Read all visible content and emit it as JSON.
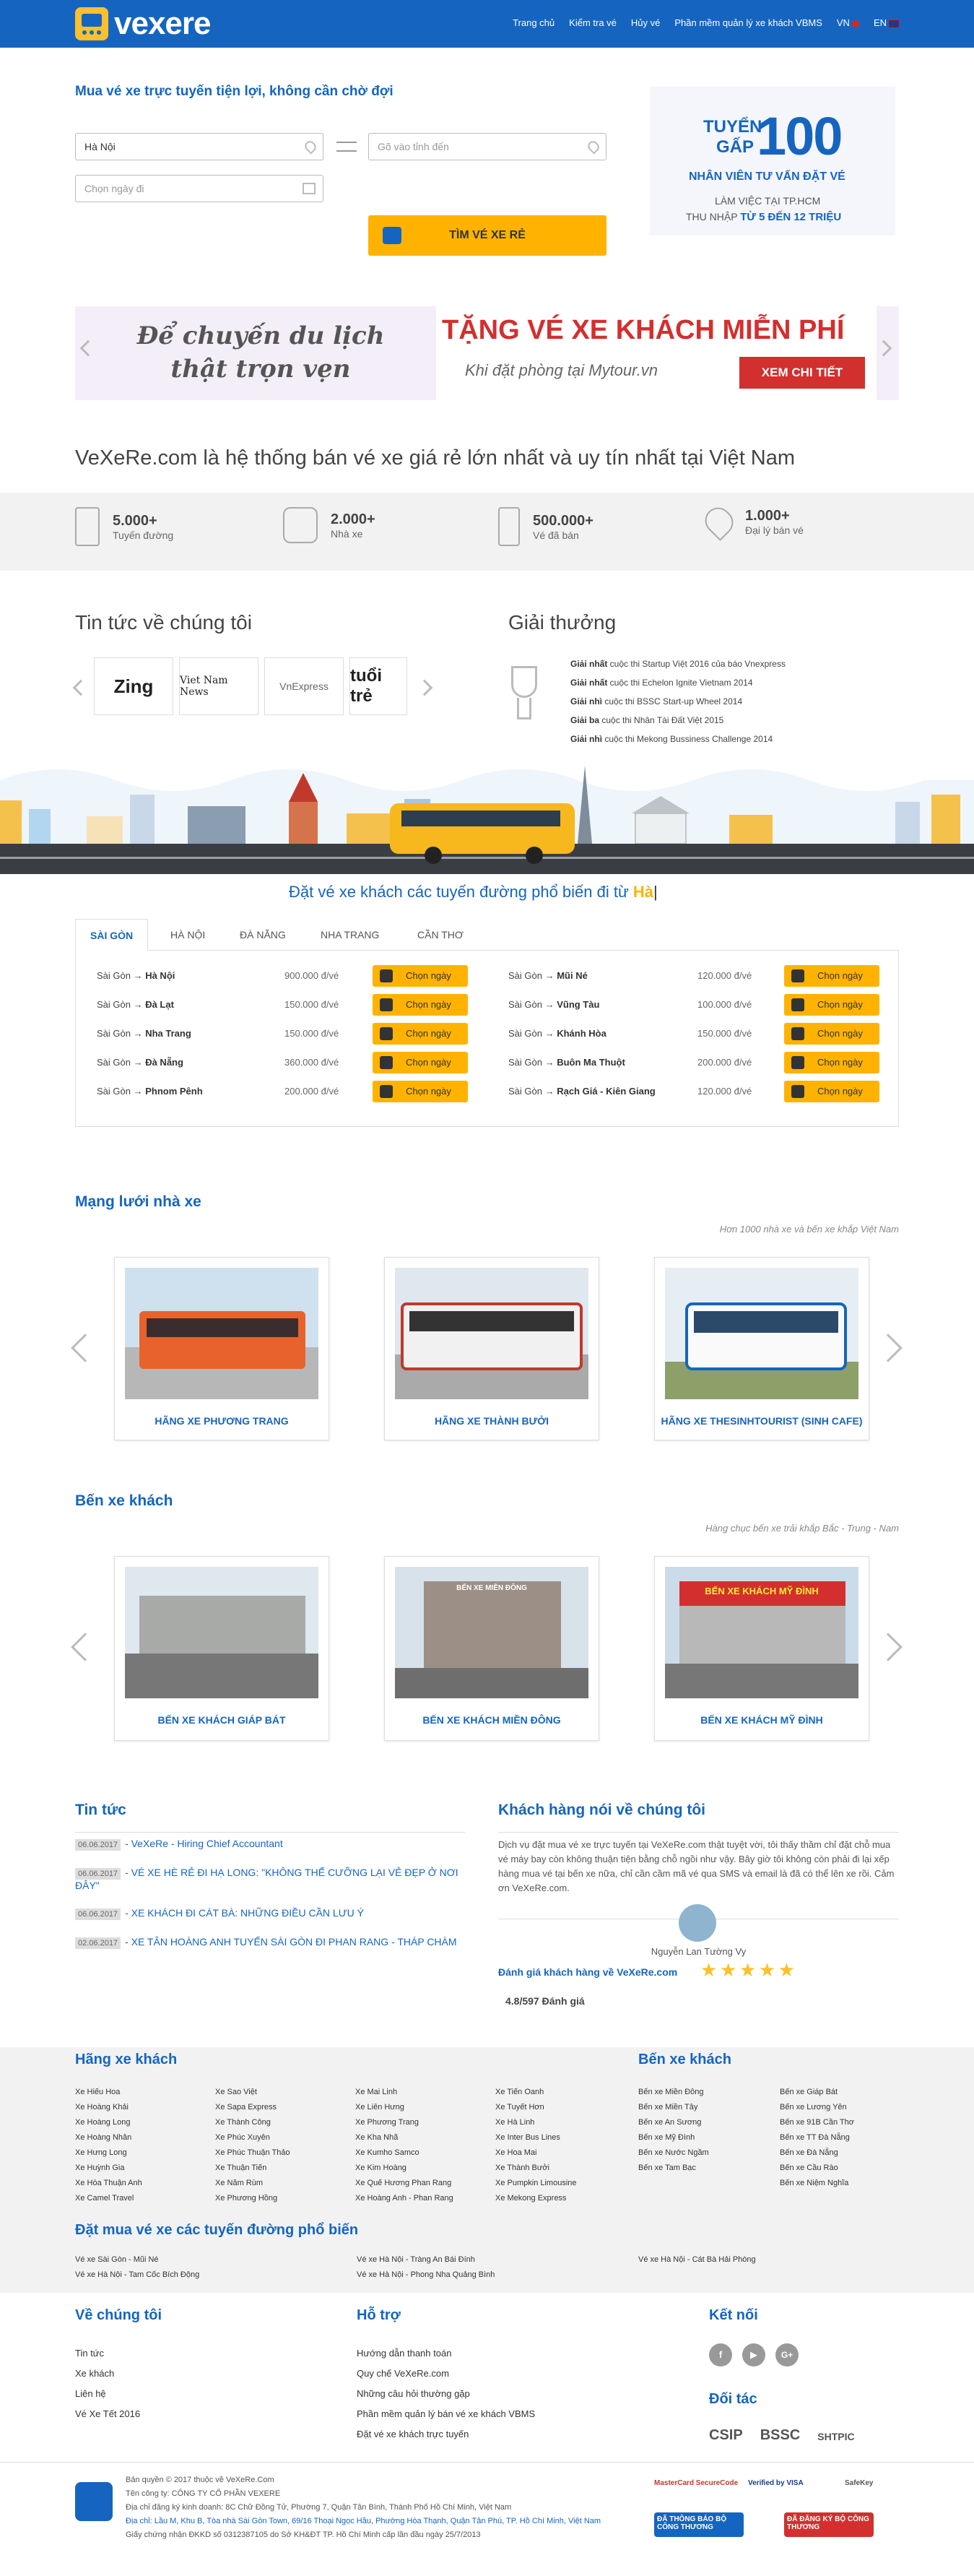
{
  "header": {
    "logo": "vexere",
    "nav": [
      "Trang chủ",
      "Kiểm tra vé",
      "Hủy vé",
      "Phần mềm quản lý xe khách VBMS"
    ],
    "lang_vn": "VN",
    "lang_en": "EN"
  },
  "search": {
    "heading": "Mua vé xe trực tuyến tiện lợi, không cần chờ đợi",
    "from_value": "Hà Nội",
    "to_placeholder": "Gõ vào tỉnh đến",
    "date_placeholder": "Chọn ngày đi",
    "button": "TÌM VÉ XE RẺ"
  },
  "hiring": {
    "line1": "TUYỂN",
    "line2": "GẤP",
    "number": "100",
    "line3": "NHÂN VIÊN TƯ VẤN ĐẶT VÉ",
    "line4": "LÀM VIỆC TẠI TP.HCM",
    "line5a": "THU NHẬP",
    "line5b": "TỪ 5 ĐẾN 12 TRIỆU"
  },
  "banner": {
    "left1": "Để chuyến du lịch",
    "left2": "thật trọn vẹn",
    "title": "TẶNG VÉ XE KHÁCH MIỄN PHÍ",
    "sub": "Khi đặt phòng tại Mytour.vn",
    "cta": "XEM CHI TIẾT"
  },
  "intro": "VeXeRe.com là hệ thống bán vé xe giá rẻ lớn nhất và uy tín nhất tại Việt Nam",
  "stats": [
    {
      "num": "5.000+",
      "label": "Tuyến đường"
    },
    {
      "num": "2.000+",
      "label": "Nhà xe"
    },
    {
      "num": "500.000+",
      "label": "Vé đã bán"
    },
    {
      "num": "1.000+",
      "label": "Đại lý bán vé"
    }
  ],
  "news_about": {
    "title": "Tin tức về chúng tôi",
    "logos": [
      "Zing",
      "Viet Nam News",
      "VnExpress",
      "tuổi trẻ"
    ]
  },
  "awards": {
    "title": "Giải thưởng",
    "items": [
      {
        "rank": "Giải nhất",
        "text": " cuộc thi Startup Việt 2016 của báo Vnexpress"
      },
      {
        "rank": "Giải nhất",
        "text": " cuộc thi Echelon Ignite Vietnam 2014"
      },
      {
        "rank": "Giải nhì",
        "text": " cuộc thi BSSC Start-up Wheel 2014"
      },
      {
        "rank": "Giải ba",
        "text": " cuộc thi Nhân Tài Đất Việt 2015"
      },
      {
        "rank": "Giải nhì",
        "text": " cuộc thi Mekong Bussiness Challenge 2014"
      }
    ]
  },
  "popular": {
    "title": "Đặt vé xe khách các tuyến đường phổ biến đi từ",
    "city": "Hà",
    "tabs": [
      "SÀI GÒN",
      "HÀ NỘI",
      "ĐÀ NẴNG",
      "NHA TRANG",
      "CẦN THƠ"
    ],
    "choose": "Chọn ngày",
    "left": [
      {
        "from": "Sài Gòn → ",
        "to": "Hà Nội",
        "price": "900.000 đ/vé"
      },
      {
        "from": "Sài Gòn → ",
        "to": "Đà Lạt",
        "price": "150.000 đ/vé"
      },
      {
        "from": "Sài Gòn → ",
        "to": "Nha Trang",
        "price": "150.000 đ/vé"
      },
      {
        "from": "Sài Gòn → ",
        "to": "Đà Nẵng",
        "price": "360.000 đ/vé"
      },
      {
        "from": "Sài Gòn → ",
        "to": "Phnom Pênh",
        "price": "200.000 đ/vé"
      }
    ],
    "right": [
      {
        "from": "Sài Gòn → ",
        "to": "Mũi Né",
        "price": "120.000 đ/vé"
      },
      {
        "from": "Sài Gòn → ",
        "to": "Vũng Tàu",
        "price": "100.000 đ/vé"
      },
      {
        "from": "Sài Gòn → ",
        "to": "Khánh Hòa",
        "price": "150.000 đ/vé"
      },
      {
        "from": "Sài Gòn → ",
        "to": "Buôn Ma Thuột",
        "price": "200.000 đ/vé"
      },
      {
        "from": "Sài Gòn → ",
        "to": "Rạch Giá - Kiên Giang",
        "price": "120.000 đ/vé"
      }
    ]
  },
  "network": {
    "title": "Mạng lưới nhà xe",
    "sub": "Hơn 1000 nhà xe và bến xe khắp Việt Nam",
    "cards": [
      "HÃNG XE PHƯƠNG TRANG",
      "HÃNG XE THÀNH BƯỞI",
      "HÃNG XE THESINHTOURIST (SINH CAFE)"
    ]
  },
  "stations": {
    "title": "Bến xe khách",
    "sub": "Hàng chục bến xe trải khắp Bắc - Trung - Nam",
    "cards": [
      "BẾN XE KHÁCH GIÁP BÁT",
      "BẾN XE KHÁCH MIỀN ĐÔNG",
      "BẾN XE KHÁCH MỸ ĐÌNH"
    ],
    "sign1": "BẾN XE MIỀN ĐÔNG",
    "sign2": "BẾN XE KHÁCH MỸ ĐÌNH"
  },
  "news": {
    "title": "Tin tức",
    "items": [
      {
        "date": "06.06.2017",
        "text": "- VeXeRe - Hiring Chief Accountant"
      },
      {
        "date": "06.06.2017",
        "text": "- VÉ XE HÈ RẺ ĐI HẠ LONG: \"KHÔNG THỂ CƯỠNG LẠI VẺ ĐẸP Ở NƠI ĐÂY\""
      },
      {
        "date": "06.06.2017",
        "text": "- XE KHÁCH ĐI CÁT BÀ: NHỮNG ĐIỀU CẦN LƯU Ý"
      },
      {
        "date": "02.06.2017",
        "text": "- XE TÂN HOÀNG ANH TUYẾN SÀI GÒN ĐI PHAN RANG - THÁP CHÀM"
      }
    ]
  },
  "testimonial": {
    "title": "Khách hàng nói về chúng tôi",
    "text": "Dịch vụ đặt mua vé xe trực tuyến tại VeXeRe.com thật tuyệt vời, tôi thấy thầm chỉ đặt chỗ mua vé máy bay còn không thuận tiện bằng chỗ ngồi như vậy. Bây giờ tôi không còn phải đi lại xếp hàng mua vé tại bến xe nữa, chỉ cần cầm mã vé qua SMS và email là đã có thể lên xe rồi. Cảm ơn VeXeRe.com.",
    "name": "Nguyễn Lan Tường Vy",
    "rating_label": "Đánh giá khách hàng về VeXeRe.com",
    "rating_score": "4.8/597 Đánh giá",
    "stars": 5
  },
  "footer_lists": {
    "companies_title": "Hãng xe khách",
    "companies": [
      [
        "Xe Hiếu Hoa",
        "Xe Hoàng Khải",
        "Xe Hoàng Long",
        "Xe Hoàng Nhân",
        "Xe Hưng Long",
        "Xe Huỳnh Gia",
        "Xe Hòa Thuận Anh",
        "Xe Camel Travel"
      ],
      [
        "Xe Sao Việt",
        "Xe Sapa Express",
        "Xe Thành Công",
        "Xe Phúc Xuyên",
        "Xe Phúc Thuận Thảo",
        "Xe Thuận Tiến",
        "Xe Năm Rùm",
        "Xe Phương Hồng"
      ],
      [
        "Xe Mai Linh",
        "Xe Liên Hưng",
        "Xe Phương Trang",
        "Xe Kha Nhã",
        "Xe Kumho Samco",
        "Xe Kim Hoàng",
        "Xe Quế Hương Phan Rang",
        "Xe Hoàng Anh - Phan Rang"
      ],
      [
        "Xe Tiến Oanh",
        "Xe Tuyết Hơn",
        "Xe Hà Linh",
        "Xe Inter Bus Lines",
        "Xe Hoa Mai",
        "Xe Thành Bưởi",
        "Xe Pumpkin Limousine",
        "Xe Mekong Express"
      ]
    ],
    "stations_title": "Bến xe khách",
    "stations": [
      [
        "Bến xe Miền Đông",
        "Bến xe Miền Tây",
        "Bến xe An Sương",
        "Bến xe Mỹ Đình",
        "Bến xe Nước Ngầm",
        "Bến xe Tam Bạc"
      ],
      [
        "Bến xe Giáp Bát",
        "Bến xe Lương Yên",
        "Bến xe 91B Cần Thơ",
        "Bến xe TT Đà Nẵng",
        "Bến xe Đà Nẵng",
        "Bến xe Cầu Rào",
        "Bến xe Niệm Nghĩa"
      ]
    ],
    "routes_title": "Đặt mua vé xe các tuyến đường phổ biến",
    "routes": [
      [
        "Vé xe Sài Gòn - Mũi Né",
        "Vé xe Hà Nội - Tam Cốc Bích Động"
      ],
      [
        "Vé xe Hà Nội - Tràng An Bái Đính",
        "Vé xe Hà Nội - Phong Nha Quảng Bình"
      ],
      [
        "Vé xe Hà Nội - Cát Bà Hải Phòng"
      ]
    ]
  },
  "footer": {
    "about_title": "Về chúng tôi",
    "about": [
      "Tin tức",
      "Xe khách",
      "Liên hệ",
      "Vé Xe Tết 2016"
    ],
    "support_title": "Hỗ trợ",
    "support": [
      "Hướng dẫn thanh toán",
      "Quy chế VeXeRe.com",
      "Những câu hỏi thường gặp",
      "Phần mềm quản lý bán vé xe khách VBMS",
      "Đặt vé xe khách trực tuyến"
    ],
    "connect_title": "Kết nối",
    "partners_title": "Đối tác",
    "partners": [
      "CSIP",
      "BSSC",
      "SHTPIC"
    ],
    "copyright": [
      "Bản quyền © 2017 thuộc về VeXeRe.Com",
      "Tên công ty: CÔNG TY CỔ PHẦN VEXERE",
      "Địa chỉ đăng ký kinh doanh: 8C Chữ Đồng Tử, Phường 7, Quận Tân Bình, Thành Phố Hồ Chí Minh, Việt Nam",
      "Địa chỉ: Lầu M, Khu B, Tòa nhà Sài Gòn Town, 69/16 Thoại Ngọc Hầu, Phường Hòa Thạnh, Quận Tân Phú, TP. Hồ Chí Minh, Việt Nam",
      "Giấy chứng nhận ĐKKD số 0312387105 do Sở KH&ĐT TP. Hồ Chí Minh cấp lần đầu ngày 25/7/2013"
    ],
    "badges": [
      "MasterCard SecureCode",
      "Verified by VISA",
      "SafeKey",
      "ĐÃ THÔNG BÁO BỘ CÔNG THƯƠNG",
      "ĐÃ ĐĂNG KÝ BỘ CÔNG THƯƠNG"
    ]
  },
  "colors": {
    "primary": "#1565c0",
    "accent": "#ffb300",
    "banner_red": "#d32f2f"
  }
}
